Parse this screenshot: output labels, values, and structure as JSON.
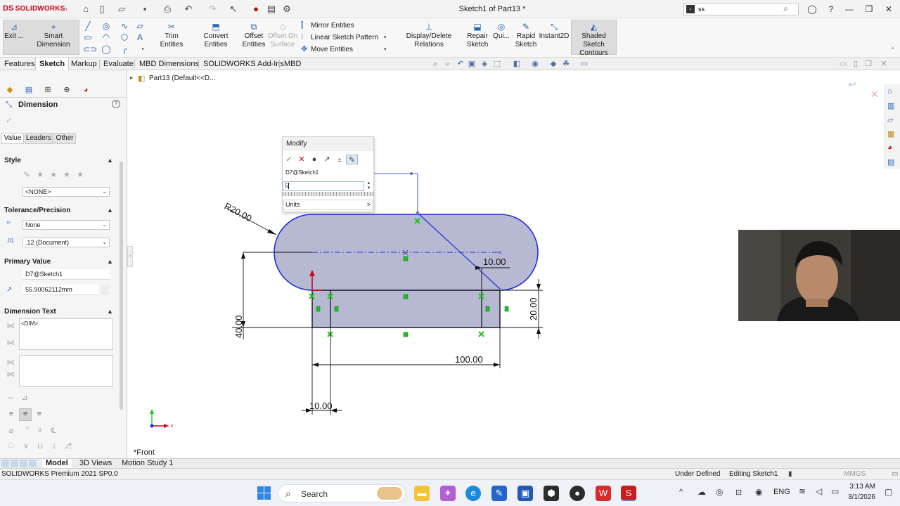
{
  "app": {
    "logo": "SOLIDWORKS",
    "logo_mark": "DS",
    "window_title": "Sketch1 of Part13 *",
    "search_value": "ss"
  },
  "ribbon": {
    "exit": "Exit ...",
    "smart_dimension": "Smart Dimension",
    "trim_entities": "Trim Entities",
    "convert_entities": "Convert Entities",
    "offset_entities": [
      "Offset",
      "Entities"
    ],
    "offset_on_surface": [
      "Offset On",
      "Surface"
    ],
    "mirror_entities": "Mirror Entities",
    "linear_sketch_pattern": "Linear Sketch Pattern",
    "move_entities": "Move Entities",
    "display_delete_relations": "Display/Delete Relations",
    "repair_sketch": [
      "Repair",
      "Sketch"
    ],
    "quick": "Qui...",
    "rapid_sketch": [
      "Rapid",
      "Sketch"
    ],
    "instant2d": "Instant2D",
    "shaded_sketch_contours": [
      "Shaded Sketch",
      "Contours"
    ]
  },
  "tabs": [
    "Features",
    "Sketch",
    "Markup",
    "Evaluate",
    "MBD Dimensions",
    "SOLIDWORKS Add-Ins",
    "MBD"
  ],
  "tree": {
    "part": "Part13  (Default<<D..."
  },
  "panel": {
    "title": "Dimension",
    "subtabs": [
      "Value",
      "Leaders",
      "Other"
    ],
    "style_label": "Style",
    "style_value": "<NONE>",
    "tolerance_label": "Tolerance/Precision",
    "tolerance_value": "None",
    "precision_value": ".12 (Document)",
    "primary_value_label": "Primary Value",
    "primary_ref": "D7@Sketch1",
    "primary_value": "55.90062112mm",
    "dimension_text_label": "Dimension Text",
    "dim_text": "<DIM>"
  },
  "modify": {
    "title": "Modify",
    "ref": "D7@Sketch1",
    "value": "5",
    "units": "Units",
    "units_arrow": ">"
  },
  "sketch": {
    "dims": {
      "radius": "R20.00",
      "d10_top": "10.00",
      "d20": "20.00",
      "d40": "40.00",
      "d100": "100.00",
      "d10_bottom": "10.00"
    },
    "view_label": "*Front"
  },
  "bottom_tabs": [
    "Model",
    "3D Views",
    "Motion Study 1"
  ],
  "status": {
    "product": "SOLIDWORKS Premium 2021 SP0.0",
    "defined": "Under Defined",
    "editing": "Editing Sketch1",
    "units": "MMGS"
  },
  "taskbar": {
    "search": "Search",
    "lang": "ENG",
    "time": "3:13 AM",
    "date": "3/1/2026"
  },
  "colors": {
    "sketch_blue": "#1f2fd8",
    "fill": "#b7b9d3",
    "accent_red": "#d0021b",
    "relation_green": "#1ec41e"
  }
}
